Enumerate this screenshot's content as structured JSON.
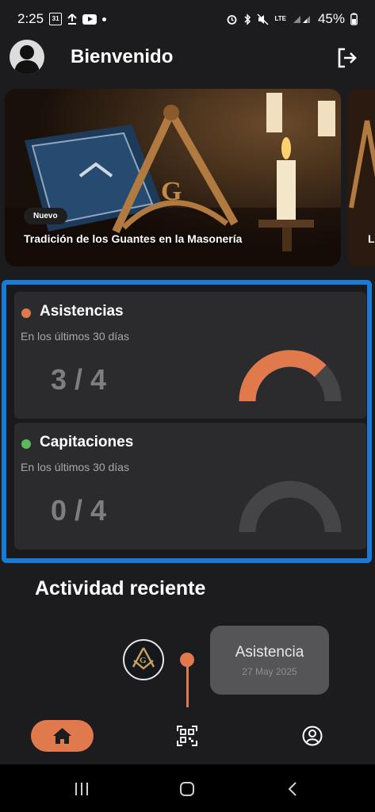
{
  "status_bar": {
    "time": "2:25",
    "calendar_day": "31",
    "network": "LTE",
    "battery": "45%"
  },
  "header": {
    "title": "Bienvenido",
    "avatar_icon": "user-silhouette-icon",
    "logout_icon": "logout-icon"
  },
  "carousel": {
    "cards": [
      {
        "badge": "Nuevo",
        "title": "Tradición de los Guantes en la Masonería"
      },
      {
        "title": "L"
      }
    ]
  },
  "stats": [
    {
      "title": "Asistencias",
      "subtitle": "En los últimos 30 días",
      "value": "3 / 4",
      "fraction": 0.75,
      "color": "#e07a4c"
    },
    {
      "title": "Capitaciones",
      "subtitle": "En los últimos 30 días",
      "value": "0 / 4",
      "fraction": 0.0,
      "color": "#5cb85c"
    }
  ],
  "activity": {
    "title": "Actividad reciente",
    "items": [
      {
        "label": "Asistencia",
        "date": "27 May 2025"
      }
    ]
  },
  "nav": {
    "items": [
      "home-icon",
      "qr-code-icon",
      "profile-icon"
    ]
  },
  "colors": {
    "accent": "#e07a4c",
    "frame": "#1a7ad8"
  }
}
